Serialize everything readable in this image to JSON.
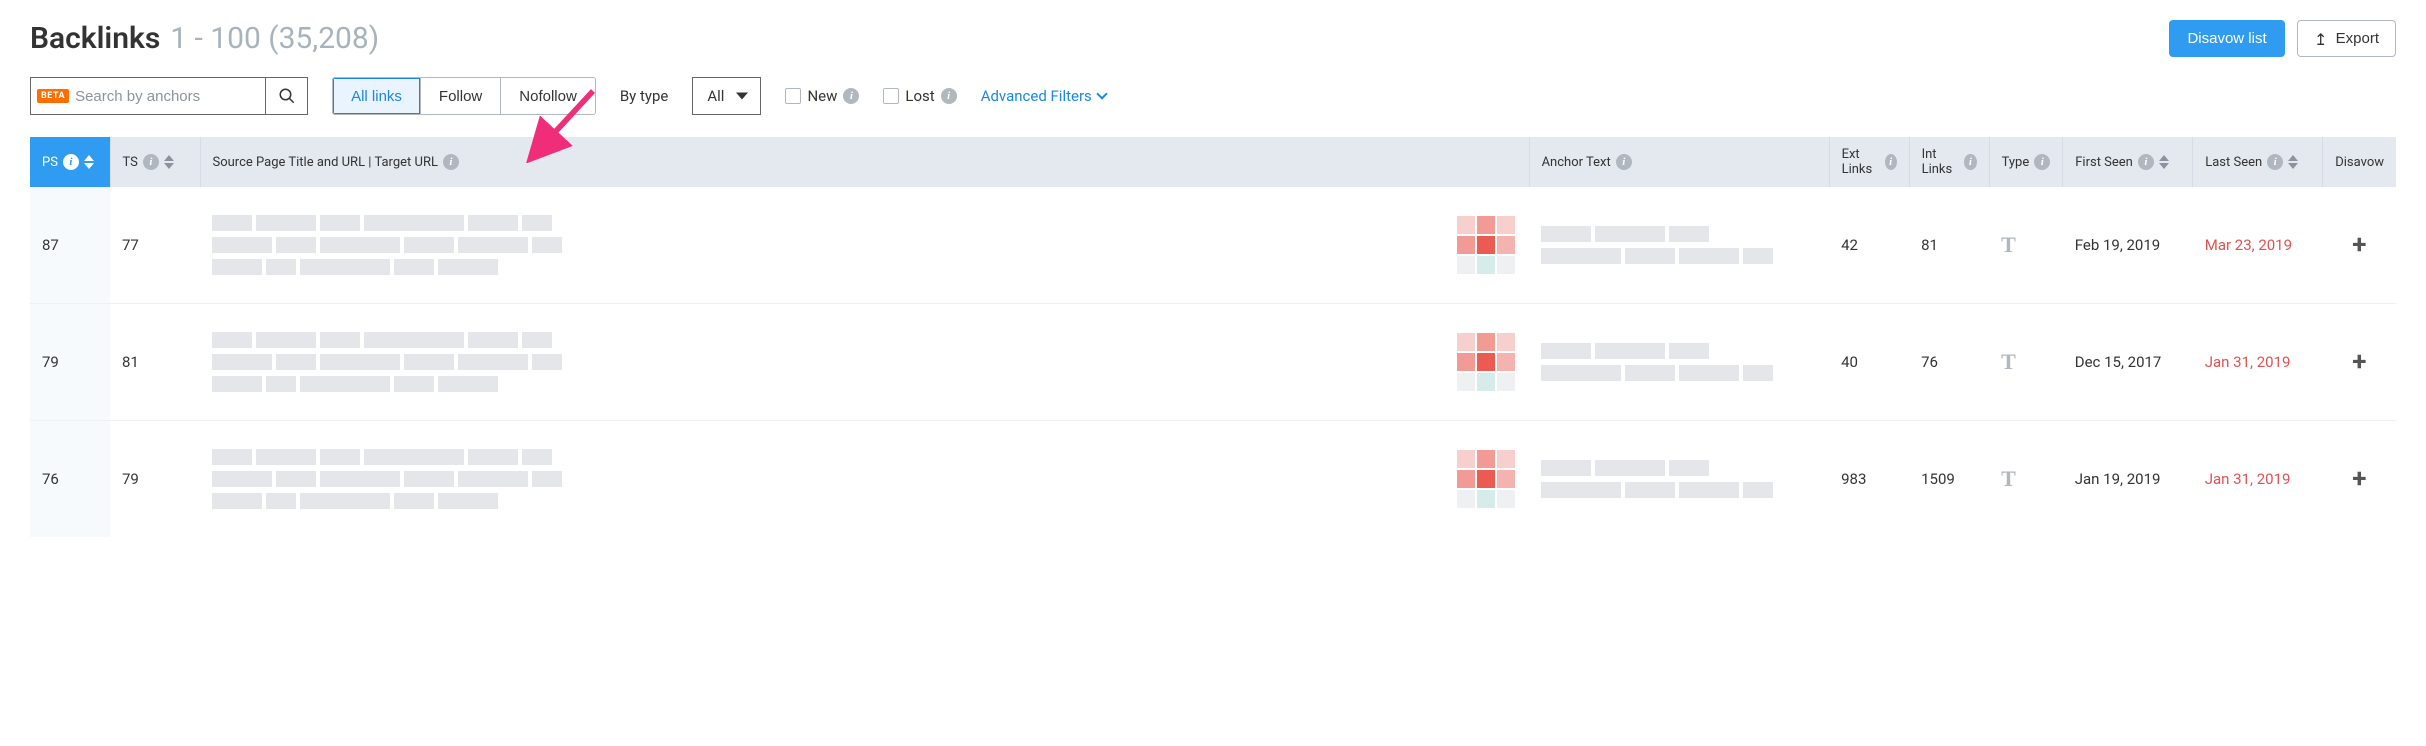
{
  "header": {
    "title": "Backlinks",
    "range": "1 - 100 (35,208)",
    "disavow_list": "Disavow list",
    "export": "Export"
  },
  "toolbar": {
    "beta": "BETA",
    "search_placeholder": "Search by anchors",
    "seg_all": "All links",
    "seg_follow": "Follow",
    "seg_nofollow": "Nofollow",
    "bytype_label": "By type",
    "bytype_value": "All",
    "new_label": "New",
    "lost_label": "Lost",
    "adv_filters": "Advanced Filters"
  },
  "columns": {
    "ps": "PS",
    "ts": "TS",
    "source": "Source Page Title and URL | Target URL",
    "anchor": "Anchor Text",
    "ext": "Ext Links",
    "int": "Int Links",
    "type": "Type",
    "first": "First Seen",
    "last": "Last Seen",
    "disavow": "Disavow"
  },
  "rows": [
    {
      "ps": "87",
      "ts": "77",
      "ext": "42",
      "int": "81",
      "type": "T",
      "first": "Feb 19, 2019",
      "last": "Mar 23, 2019"
    },
    {
      "ps": "79",
      "ts": "81",
      "ext": "40",
      "int": "76",
      "type": "T",
      "first": "Dec 15, 2017",
      "last": "Jan 31, 2019"
    },
    {
      "ps": "76",
      "ts": "79",
      "ext": "983",
      "int": "1509",
      "type": "T",
      "first": "Jan 19, 2019",
      "last": "Jan 31, 2019"
    }
  ]
}
